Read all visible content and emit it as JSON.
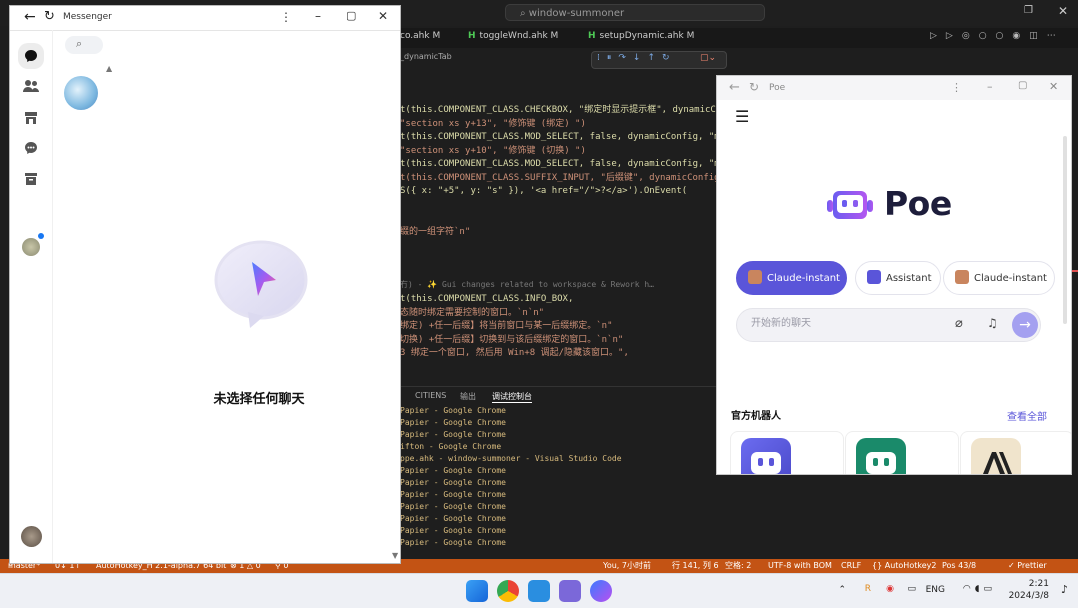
{
  "vscode": {
    "search": "window-summoner",
    "tabs": [
      "co.ahk M",
      "toggleWnd.ahk M",
      "setupDynamic.ahk M"
    ],
    "breadcrumb": "_dynamicTab",
    "code_lines": [
      "t(this.COMPONENT_CLASS.CHECKBOX, \"绑定时显示提示框\", dynamicC",
      "\"section xs y+13\", \"修饰键 (绑定)  \")",
      "t(this.COMPONENT_CLASS.MOD_SELECT, false, dynamicConfig, \"mo",
      "\"section xs y+10\", \"修饰键 (切换)  \")",
      "t(this.COMPONENT_CLASS.MOD_SELECT, false, dynamicConfig, \"mo",
      "t(this.COMPONENT_CLASS.SUFFIX_INPUT, \"后缀键\", dynamicConfig",
      "S({ x: \"+5\", y: \"s\" }), '<a href=\"/\">?</a>').OnEvent(",
      "",
      "",
      "缀的一组字符`n\"",
      "",
      "",
      "",
      "",
      "t(this.COMPONENT_CLASS.INFO_BOX,",
      "态随时绑定需要控制的窗口。`n`n\"",
      "绑定) +任一后缀】将当前窗口与某一后缀绑定。`n\"",
      "切换) +任一后缀】切换到与该后缀绑定的窗口。`n`n\"",
      "3 绑定一个窗口, 然后用 Win+8 调起/隐藏该窗口。\","
    ],
    "blame": "冇) - ✨ Gui changes related to workspace & Rework h…",
    "panel_tabs": [
      "CITIENS",
      "输出",
      "调试控制台"
    ],
    "terminal_lines": [
      "Papier - Google Chrome",
      "Papier - Google Chrome",
      "Papier - Google Chrome",
      "ifton - Google Chrome",
      "ppe.ahk - window-summoner - Visual Studio Code",
      "Papier - Google Chrome",
      "Papier - Google Chrome",
      "Papier - Google Chrome",
      "Papier - Google Chrome",
      "Papier - Google Chrome",
      "Papier - Google Chrome",
      "Papier - Google Chrome"
    ],
    "status": {
      "branch": "master*",
      "sync": "0↓ 1↑",
      "interpreter": "AutoHotkey_H 2.1-alpha.7 64 bit",
      "problems": "⊗ 1 △ 0",
      "ports": "⚲ 0",
      "git": "You, 7小时前",
      "position": "行 141, 列 6",
      "spaces": "空格: 2",
      "encoding": "UTF-8 with BOM",
      "eol": "CRLF",
      "language": "{} AutoHotkey2",
      "pos": "Pos 43/8",
      "prettier": "✓ Prettier"
    }
  },
  "messenger": {
    "title": "Messenger",
    "empty_state": "未选择任何聊天"
  },
  "poe": {
    "title": "Poe",
    "logo": "Poe",
    "chips": [
      {
        "label": "Claude-instant",
        "selected": true,
        "color": "#c9855e"
      },
      {
        "label": "Assistant",
        "selected": false,
        "color": "#5a55d9"
      },
      {
        "label": "Claude-instant",
        "selected": false,
        "color": "#c9855e"
      }
    ],
    "input_placeholder": "开始新的聊天",
    "bots_heading": "官方机器人",
    "see_all": "查看全部",
    "accent": "#5a55d9"
  },
  "taskbar": {
    "lang": "ENG",
    "time": "2:21",
    "date": "2024/3/8"
  }
}
